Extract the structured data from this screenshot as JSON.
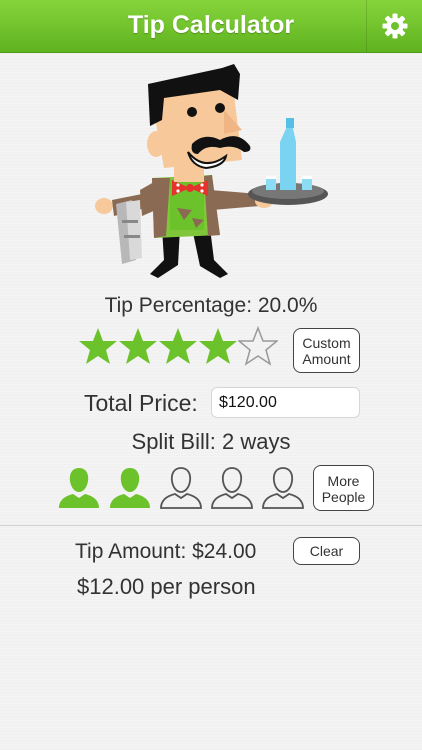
{
  "navbar": {
    "title": "Tip Calculator",
    "settings_icon": "gear-icon"
  },
  "tip": {
    "percentage_label": "Tip Percentage: 20.0%",
    "rating": 4,
    "max_rating": 5,
    "custom_label_1": "Custom",
    "custom_label_2": "Amount"
  },
  "price": {
    "label": "Total Price:",
    "value": "$120.00"
  },
  "split": {
    "label": "Split Bill: 2 ways",
    "selected_people": 2,
    "total_people_icons": 5,
    "more_label_1": "More",
    "more_label_2": "People"
  },
  "result": {
    "tip_amount": "Tip Amount: $24.00",
    "per_person": "$12.00 per person",
    "clear_label": "Clear"
  },
  "colors": {
    "accent": "#6cc22a",
    "nav_top": "#86d43c",
    "nav_bottom": "#5fb31f",
    "outline": "#555555"
  }
}
